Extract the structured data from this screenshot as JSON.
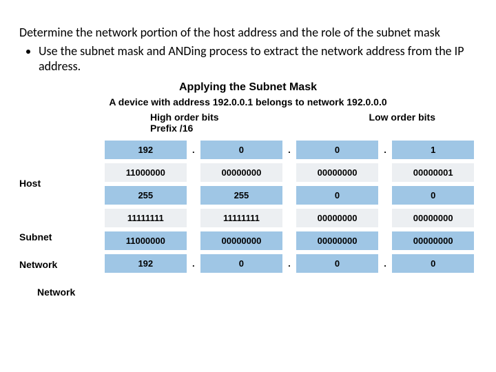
{
  "heading": "Determine the network portion of the host address and the role of the subnet mask",
  "bullet1": "Use the subnet mask and ANDing process to extract the network address from the IP address.",
  "diagram": {
    "title": "Applying the Subnet Mask",
    "subtitle": "A device with address 192.0.0.1 belongs to network 192.0.0.0",
    "high_label_line1": "High order bits",
    "high_label_line2": "Prefix /16",
    "low_label": "Low order bits",
    "side": {
      "host": "Host",
      "subnet": "Subnet",
      "network1": "Network",
      "network2": "Network"
    },
    "rows": [
      {
        "style": "blue",
        "cells": [
          "192",
          "0",
          "0",
          "1"
        ],
        "dots": true
      },
      {
        "style": "grey",
        "cells": [
          "11000000",
          "00000000",
          "00000000",
          "00000001"
        ],
        "dots": false
      },
      {
        "style": "blue",
        "cells": [
          "255",
          "255",
          "0",
          "0"
        ],
        "dots": false
      },
      {
        "style": "grey",
        "cells": [
          "11111111",
          "11111111",
          "00000000",
          "00000000"
        ],
        "dots": false
      },
      {
        "style": "blue",
        "cells": [
          "11000000",
          "00000000",
          "00000000",
          "00000000"
        ],
        "dots": false
      },
      {
        "style": "blue",
        "cells": [
          "192",
          "0",
          "0",
          "0"
        ],
        "dots": true
      }
    ],
    "dot": "."
  }
}
